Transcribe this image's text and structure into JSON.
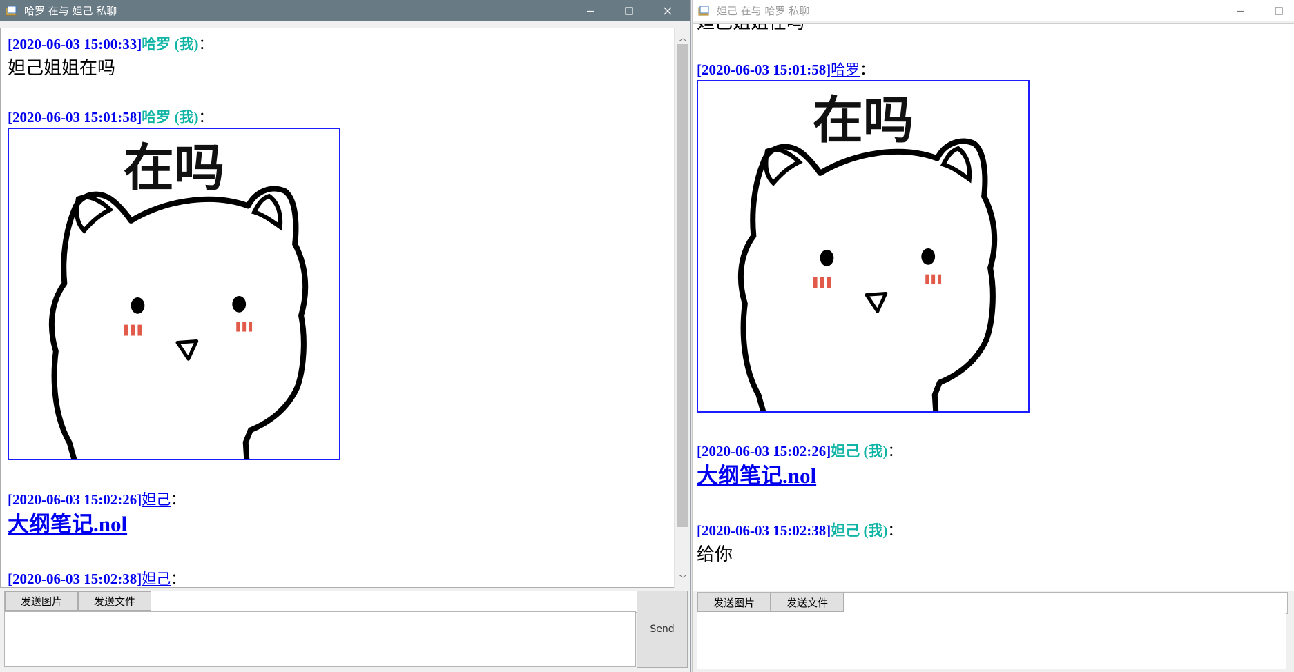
{
  "left_window": {
    "title": "哈罗 在与 妲己 私聊",
    "messages": [
      {
        "timestamp": "[2020-06-03 15:00:33]",
        "sender": "哈罗 (我)",
        "colon": "：",
        "text": "妲己姐姐在吗"
      },
      {
        "timestamp": "[2020-06-03 15:01:58]",
        "sender": "哈罗 (我)",
        "colon": "：",
        "sticker_text": "在吗"
      },
      {
        "timestamp": "[2020-06-03 15:02:26]",
        "sender": "妲己",
        "colon": "：",
        "file": "大纲笔记.nol"
      },
      {
        "timestamp": "[2020-06-03 15:02:38]",
        "sender": "妲己",
        "colon": "："
      }
    ],
    "toolbar": {
      "send_image": "发送图片",
      "send_file": "发送文件"
    },
    "send_label": "Send"
  },
  "right_window": {
    "title": "妲己 在与 哈罗 私聊",
    "partial_text": "妲己姐姐在吗",
    "messages": [
      {
        "timestamp": "[2020-06-03 15:01:58]",
        "sender": "哈罗",
        "colon": "：",
        "sticker_text": "在吗"
      },
      {
        "timestamp": "[2020-06-03 15:02:26]",
        "sender": "妲己 (我)",
        "colon": "：",
        "file": "大纲笔记.nol"
      },
      {
        "timestamp": "[2020-06-03 15:02:38]",
        "sender": "妲己 (我)",
        "colon": "：",
        "text": "给你"
      }
    ],
    "toolbar": {
      "send_image": "发送图片",
      "send_file": "发送文件"
    }
  },
  "colors": {
    "timestamp": "#0000ee",
    "self_name": "#10b5a5",
    "link": "#0000ee",
    "titlebar_active": "#687a84"
  },
  "icons": [
    "app-icon",
    "minimize-icon",
    "maximize-icon",
    "close-icon",
    "scroll-up-icon",
    "scroll-down-icon"
  ]
}
